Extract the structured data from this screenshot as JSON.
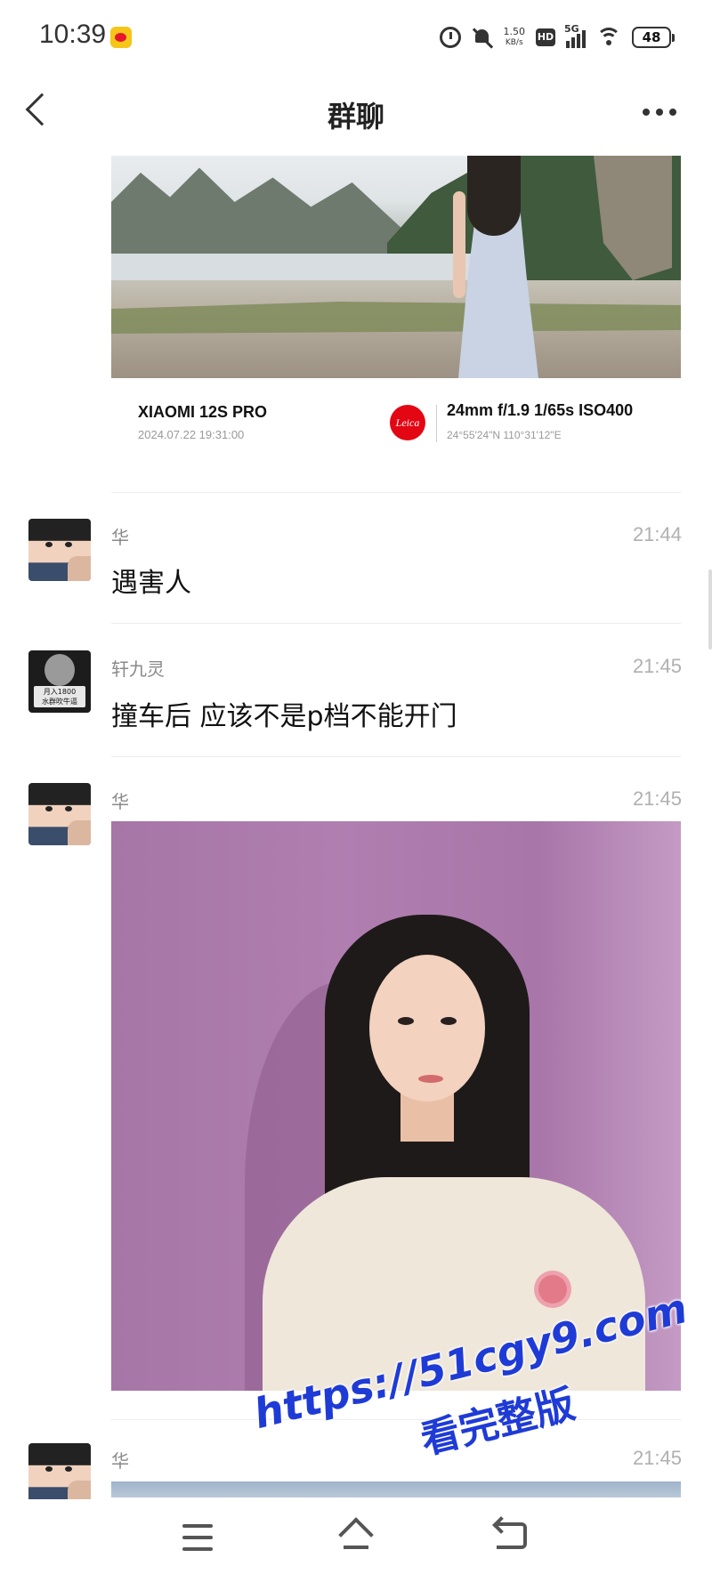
{
  "status_bar": {
    "time": "10:39",
    "net_speed_value": "1.50",
    "net_speed_unit": "KB/s",
    "hd_label": "HD",
    "network": "5G",
    "battery": "48"
  },
  "header": {
    "title": "群聊"
  },
  "photo_card": {
    "camera_model": "XIAOMI 12S PRO",
    "datetime": "2024.07.22  19:31:00",
    "brand_logo": "Leica",
    "params": "24mm  f/1.9  1/65s  ISO400",
    "gps": "24°55'24\"N  110°31'12\"E"
  },
  "messages": [
    {
      "sender": "华",
      "time": "21:44",
      "text": "遇害人"
    },
    {
      "sender": "轩九灵",
      "time": "21:45",
      "text": "撞车后  应该不是p档不能开门",
      "avatar_caption": "月入1800\n水群吹牛逼"
    },
    {
      "sender": "华",
      "time": "21:45",
      "text": ""
    },
    {
      "sender": "华",
      "time": "21:45",
      "text": ""
    }
  ],
  "watermark": {
    "url": "https://51cgy9.com",
    "subtitle": "看完整版"
  },
  "icons": {
    "back": "chevron-left-icon",
    "more": "more-dots-icon",
    "menu": "menu-icon",
    "home": "home-icon",
    "system_back": "back-icon"
  },
  "colors": {
    "watermark": "#1f3bd6",
    "leica_red": "#e30613",
    "battery_fill": "#f2a766"
  }
}
